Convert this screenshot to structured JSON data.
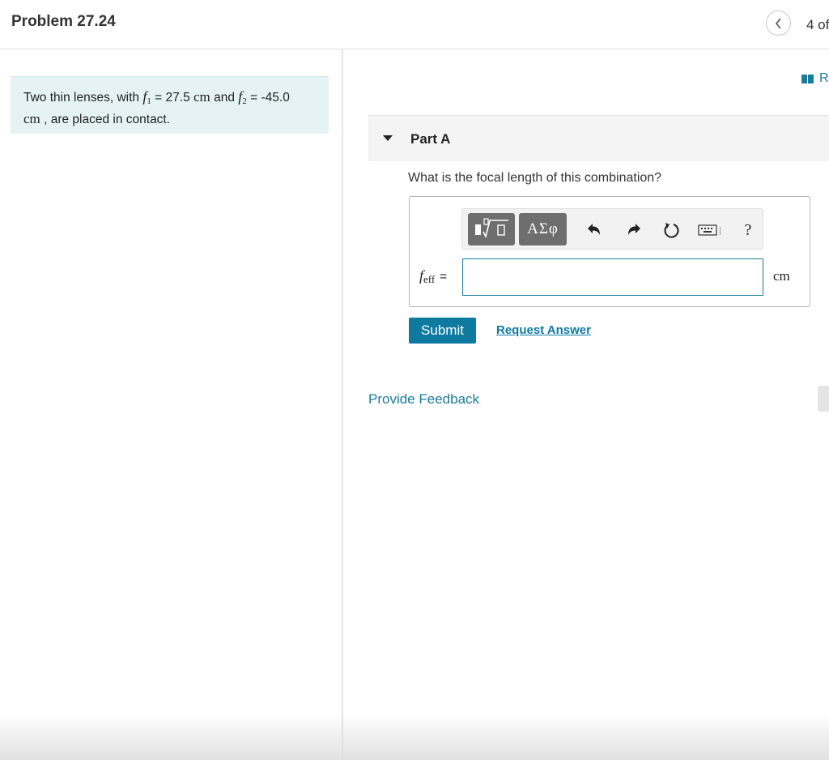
{
  "header": {
    "title": "Problem 27.24",
    "nav_count": "4 of"
  },
  "problem": {
    "text_intro": "Two thin lenses, with",
    "f1_symbol": "f",
    "f1_sub": "1",
    "f1_eq": "=",
    "f1_value": "27.5",
    "f1_unit": "cm",
    "and": "and",
    "f2_symbol": "f",
    "f2_sub": "2",
    "f2_eq": "=",
    "f2_value": "-45.0",
    "f2_unit": "cm",
    "text_end": ", are placed in contact."
  },
  "resources": {
    "label": "R"
  },
  "part": {
    "label": "Part A",
    "question": "What is the focal length of this combination?"
  },
  "toolbar": {
    "greek_label": "ΑΣφ",
    "help_label": "?",
    "icons": [
      "templates-icon",
      "greek-letters",
      "undo-icon",
      "redo-icon",
      "reset-icon",
      "keyboard-icon",
      "help-icon"
    ]
  },
  "answer": {
    "variable": "f",
    "variable_sub": "eff",
    "equals": "=",
    "value": "",
    "unit": "cm"
  },
  "buttons": {
    "submit": "Submit",
    "request_answer": "Request Answer"
  },
  "feedback": {
    "label": "Provide Feedback"
  },
  "colors": {
    "accent": "#0f7aa0",
    "link": "#1a7b9b",
    "problem_bg": "#e6f3f5",
    "toolbar_button": "#6e6e6e"
  }
}
